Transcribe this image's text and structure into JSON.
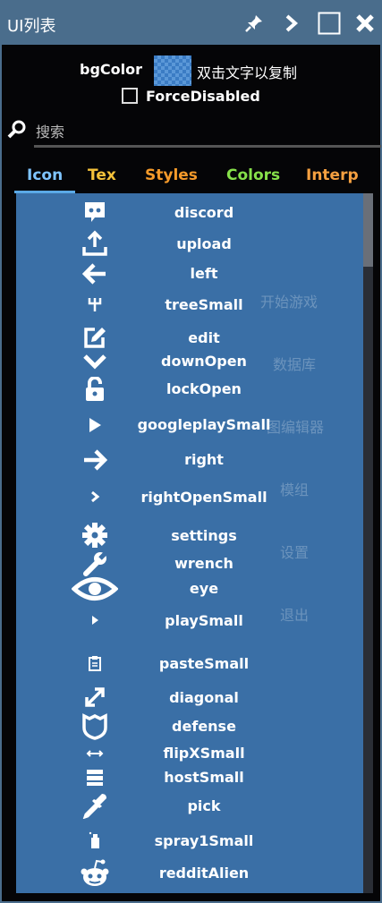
{
  "window": {
    "title": "UI列表"
  },
  "bg": {
    "label": "bgColor",
    "copy_hint": "双击文字以复制"
  },
  "force": {
    "label": "ForceDisabled"
  },
  "search": {
    "placeholder": "搜索"
  },
  "tabs": [
    {
      "label": "Icon",
      "color": "#7fc4ff"
    },
    {
      "label": "Tex",
      "color": "#f5c23a"
    },
    {
      "label": "Styles",
      "color": "#f59a2a"
    },
    {
      "label": "Colors",
      "color": "#86e04a"
    },
    {
      "label": "Interp",
      "color": "#f5a040"
    }
  ],
  "background_menu": [
    "开始游戏",
    "数据库",
    "图编辑器",
    "模组",
    "设置",
    "退出"
  ],
  "icons": [
    {
      "label": "discord",
      "icon": "discord-icon"
    },
    {
      "label": "upload",
      "icon": "upload-icon"
    },
    {
      "label": "left",
      "icon": "arrow-left-icon"
    },
    {
      "label": "treeSmall",
      "icon": "tree-icon"
    },
    {
      "label": "edit",
      "icon": "edit-icon"
    },
    {
      "label": "downOpen",
      "icon": "chevron-down-icon"
    },
    {
      "label": "lockOpen",
      "icon": "lock-open-icon"
    },
    {
      "label": "googleplaySmall",
      "icon": "play-icon"
    },
    {
      "label": "right",
      "icon": "arrow-right-icon"
    },
    {
      "label": "rightOpenSmall",
      "icon": "chevron-right-icon"
    },
    {
      "label": "settings",
      "icon": "gear-icon"
    },
    {
      "label": "wrench",
      "icon": "wrench-icon"
    },
    {
      "label": "eye",
      "icon": "eye-icon"
    },
    {
      "label": "playSmall",
      "icon": "play-small-icon"
    },
    {
      "label": "pasteSmall",
      "icon": "paste-icon"
    },
    {
      "label": "diagonal",
      "icon": "diagonal-icon"
    },
    {
      "label": "defense",
      "icon": "shield-icon"
    },
    {
      "label": "flipXSmall",
      "icon": "flip-x-icon"
    },
    {
      "label": "hostSmall",
      "icon": "host-icon"
    },
    {
      "label": "pick",
      "icon": "pick-icon"
    },
    {
      "label": "spray1Small",
      "icon": "spray-icon"
    },
    {
      "label": "redditAlien",
      "icon": "reddit-icon"
    }
  ]
}
